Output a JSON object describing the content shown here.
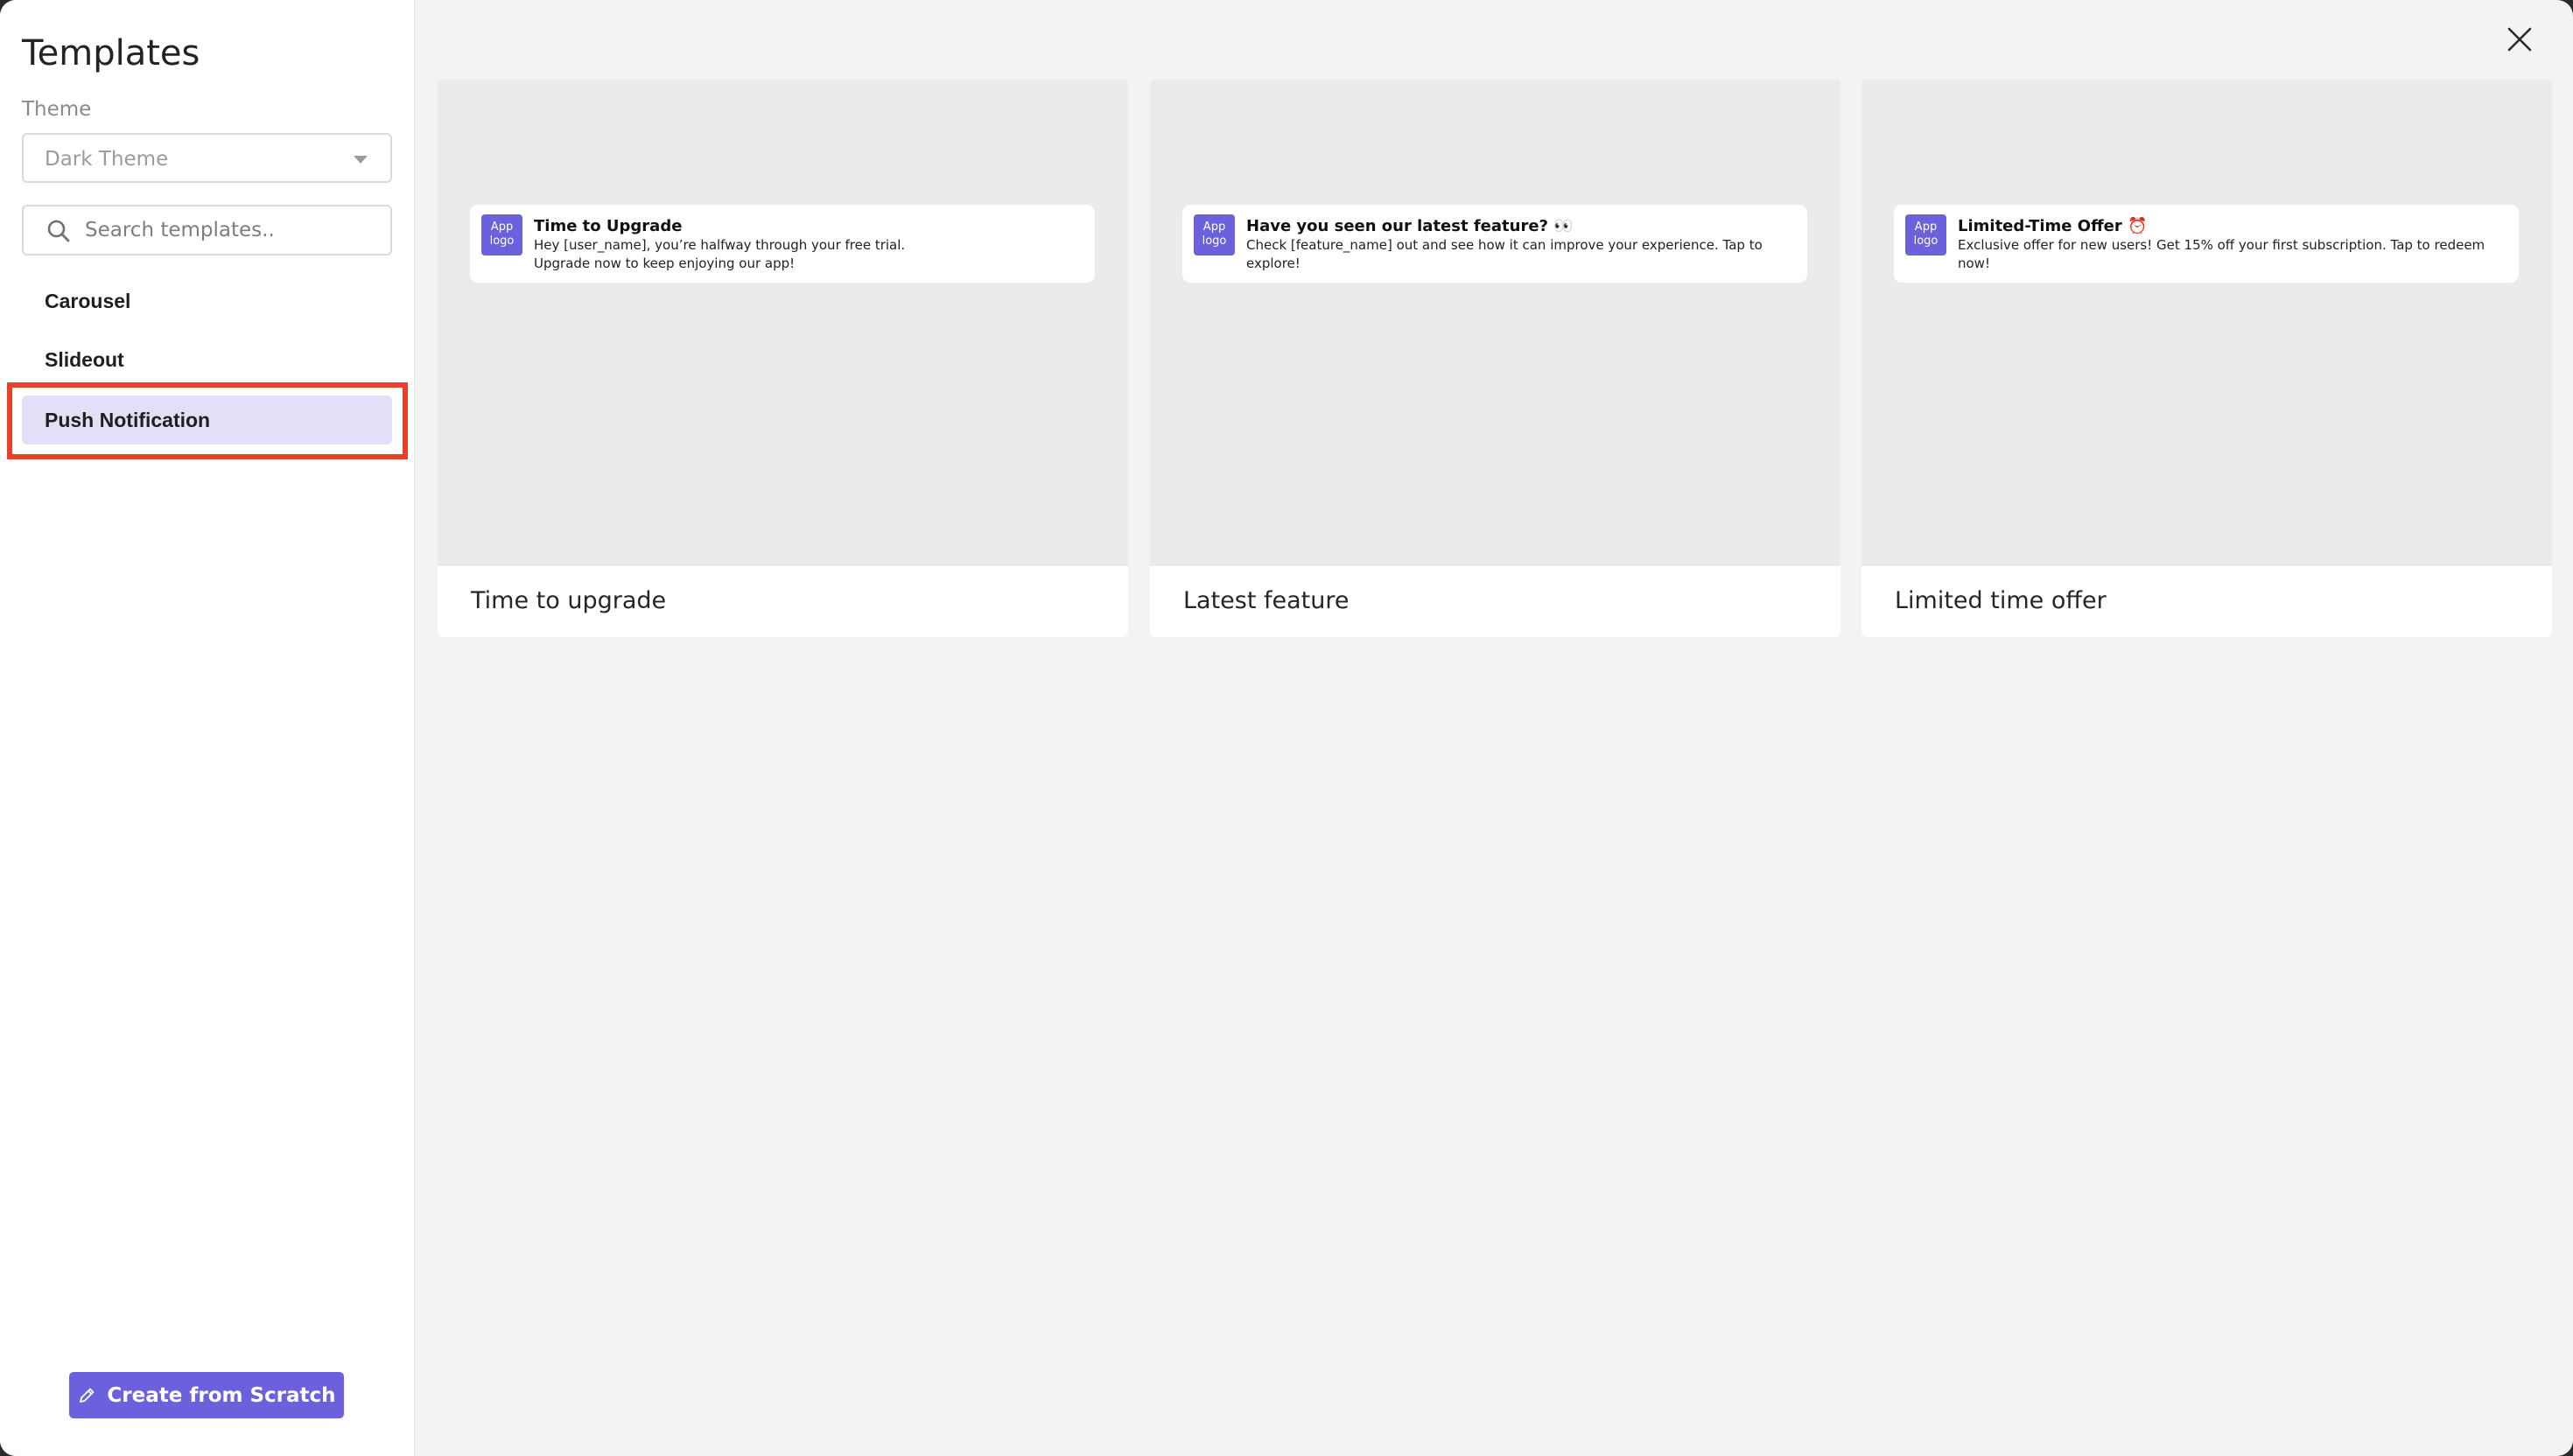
{
  "sidebar": {
    "title": "Templates",
    "theme_label": "Theme",
    "theme_value": "Dark Theme",
    "search_placeholder": "Search templates..",
    "items": [
      {
        "label": "Carousel"
      },
      {
        "label": "Slideout"
      },
      {
        "label": "Push Notification"
      }
    ],
    "active_item": "Push Notification",
    "create_button": "Create from Scratch"
  },
  "templates": [
    {
      "caption": "Time to upgrade",
      "logo": "App logo",
      "notif_title": "Time to Upgrade",
      "notif_body_1": "Hey [user_name], you’re halfway through your free trial.",
      "notif_body_2": "Upgrade now to keep enjoying our app!"
    },
    {
      "caption": "Latest feature",
      "logo": "App logo",
      "notif_title": "Have you seen our latest feature? 👀",
      "notif_body_1": "Check [feature_name] out and see how it can improve your experience. Tap to explore!",
      "notif_body_2": ""
    },
    {
      "caption": "Limited time offer",
      "logo": "App logo",
      "notif_title": "Limited-Time Offer ⏰",
      "notif_body_1": "Exclusive offer for new users! Get 15% off your first subscription. Tap to redeem now!",
      "notif_body_2": ""
    }
  ],
  "icons": {
    "close": "close-icon",
    "search": "search-icon",
    "create": "pencil-icon",
    "theme_dropdown": "chevron-down-icon"
  },
  "colors": {
    "accent": "#6b61dd",
    "active_item_bg": "#e1e0f7",
    "annotation": "#e8402b"
  }
}
